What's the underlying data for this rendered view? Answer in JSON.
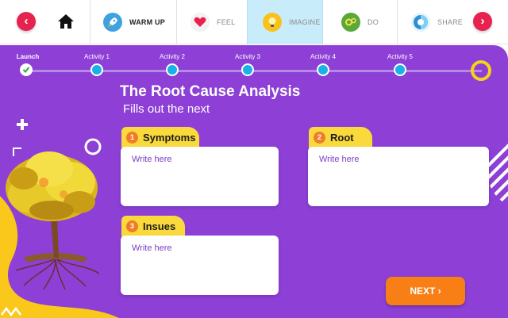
{
  "nav": {
    "prev_label": "‹",
    "next_label": "›",
    "tabs": [
      {
        "label": "WARM UP",
        "icon": "rocket-icon",
        "color": "#2f8fd6"
      },
      {
        "label": "FEEL",
        "icon": "heart-icon",
        "color": "#e8224e"
      },
      {
        "label": "IMAGINE",
        "icon": "lightbulb-icon",
        "color": "#f7c21b"
      },
      {
        "label": "DO",
        "icon": "gears-icon",
        "color": "#5aa83a"
      },
      {
        "label": "SHARE",
        "icon": "share-icon",
        "color": "#2f8fd6"
      }
    ]
  },
  "progress": {
    "steps": [
      "Launch",
      "Activity 1",
      "Activity 2",
      "Activity 3",
      "Activity 4",
      "Activity 5"
    ]
  },
  "main": {
    "title": "The Root Cause Analysis",
    "subtitle": "Fills out the next"
  },
  "cards": [
    {
      "number": "1",
      "label": "Symptoms",
      "placeholder": "Write here"
    },
    {
      "number": "2",
      "label": "Root",
      "placeholder": "Write here"
    },
    {
      "number": "3",
      "label": "Insues",
      "placeholder": "Write here"
    }
  ],
  "next_button": {
    "label": "NEXT ›"
  },
  "colors": {
    "stage_purple": "#8d3fd6",
    "nav_arrow_red": "#e8224e",
    "tag_yellow": "#f9d93b",
    "number_orange": "#f07c27",
    "next_orange": "#f77f16",
    "step_blue": "#1ab0e8",
    "selected_tab_blue": "#c9ecfb"
  }
}
